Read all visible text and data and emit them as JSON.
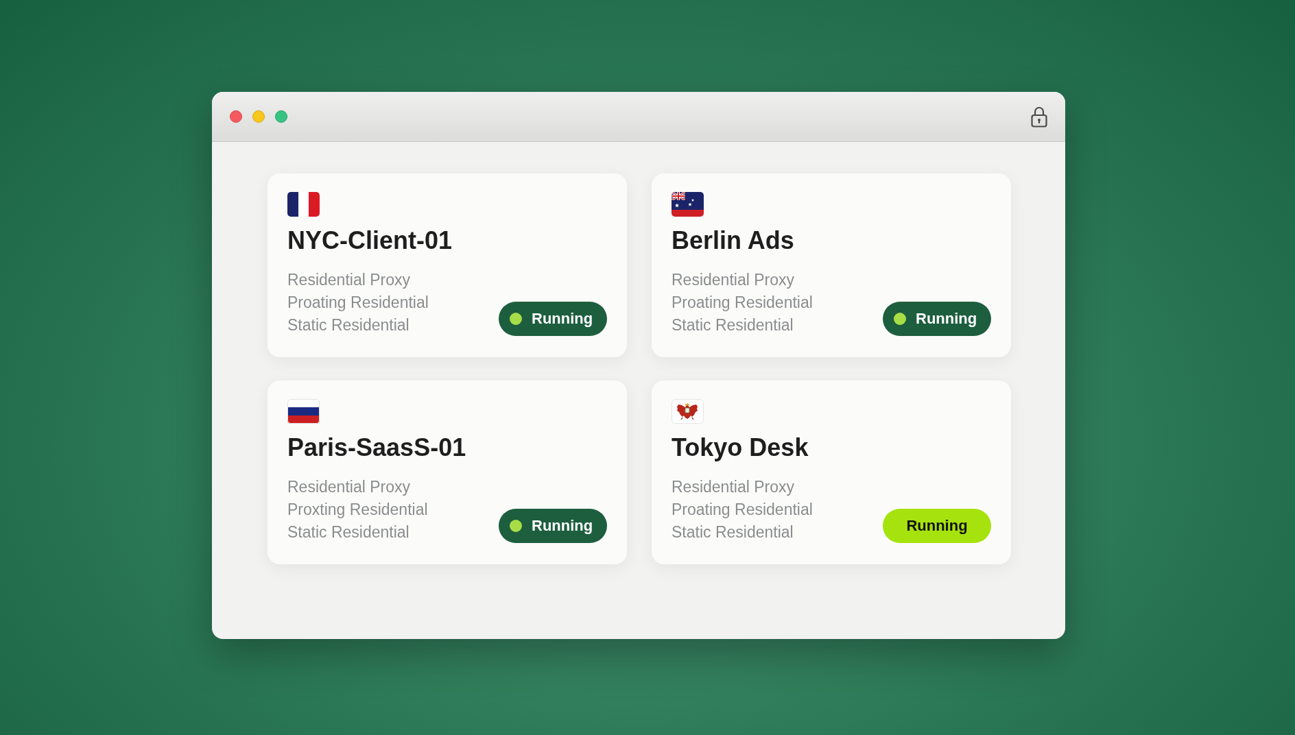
{
  "cards": [
    {
      "name": "NYC-Client-01",
      "details": [
        "Residential Proxy",
        "Proating Residential",
        "Static Residential"
      ],
      "status": {
        "label": "Running",
        "highlighted": false
      }
    },
    {
      "name": "Berlin Ads",
      "details": [
        "Residential Proxy",
        "Proating Residential",
        "Static Residential"
      ],
      "status": {
        "label": "Running",
        "highlighted": false
      }
    },
    {
      "name": "Paris-SaasS-01",
      "details": [
        "Residential Proxy",
        "Proxting Residential",
        "Static Residential"
      ],
      "status": {
        "label": "Running",
        "highlighted": false
      }
    },
    {
      "name": "Tokyo Desk",
      "details": [
        "Residential Proxy",
        "Proating Residential",
        "Static Residential"
      ],
      "status": {
        "label": "Running",
        "highlighted": true
      }
    }
  ]
}
